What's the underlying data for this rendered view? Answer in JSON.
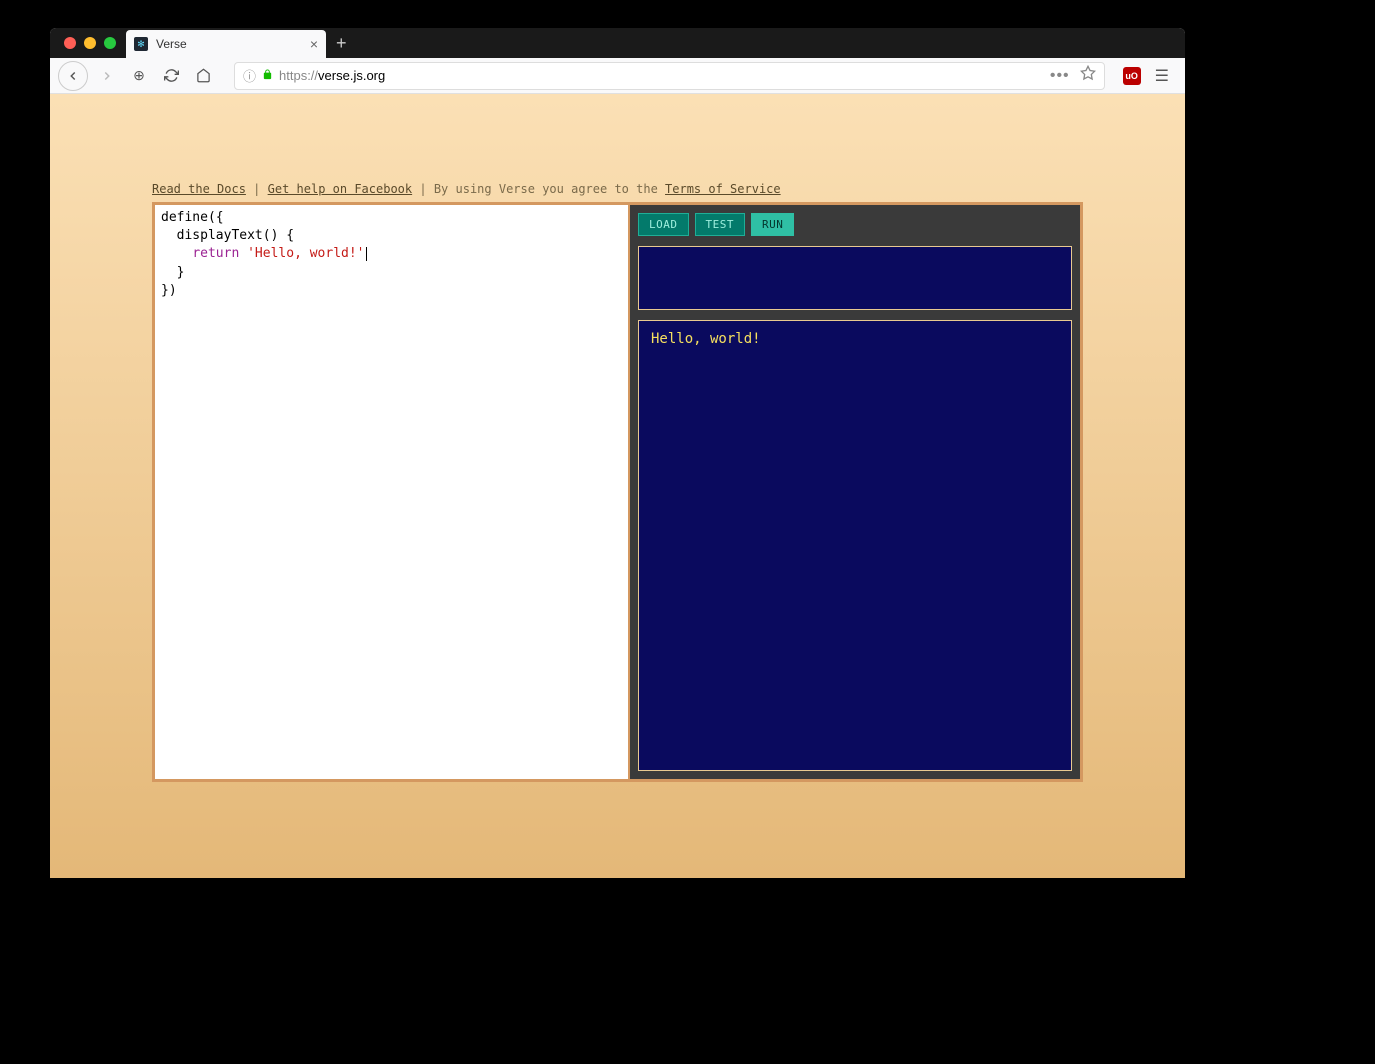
{
  "browser": {
    "tab_title": "Verse",
    "url_scheme": "https://",
    "url_host": "verse.js.org",
    "traffic_lights": [
      "close",
      "minimize",
      "zoom"
    ]
  },
  "toplinks": {
    "docs": "Read the Docs",
    "facebook": "Get help on Facebook",
    "agree_text": "By using Verse you agree to the",
    "tos": "Terms of Service",
    "sep": "|"
  },
  "editor": {
    "tokens": {
      "define_open": "define({",
      "fn_sig": "displayText() {",
      "return_kw": "return",
      "string_lit": "'Hello, world!'",
      "close_brace": "}",
      "close_call": "})"
    }
  },
  "buttons": {
    "load": "LOAD",
    "test": "TEST",
    "run": "RUN"
  },
  "output": {
    "hello": "Hello, world!"
  },
  "ext": {
    "ublock": "uO"
  }
}
